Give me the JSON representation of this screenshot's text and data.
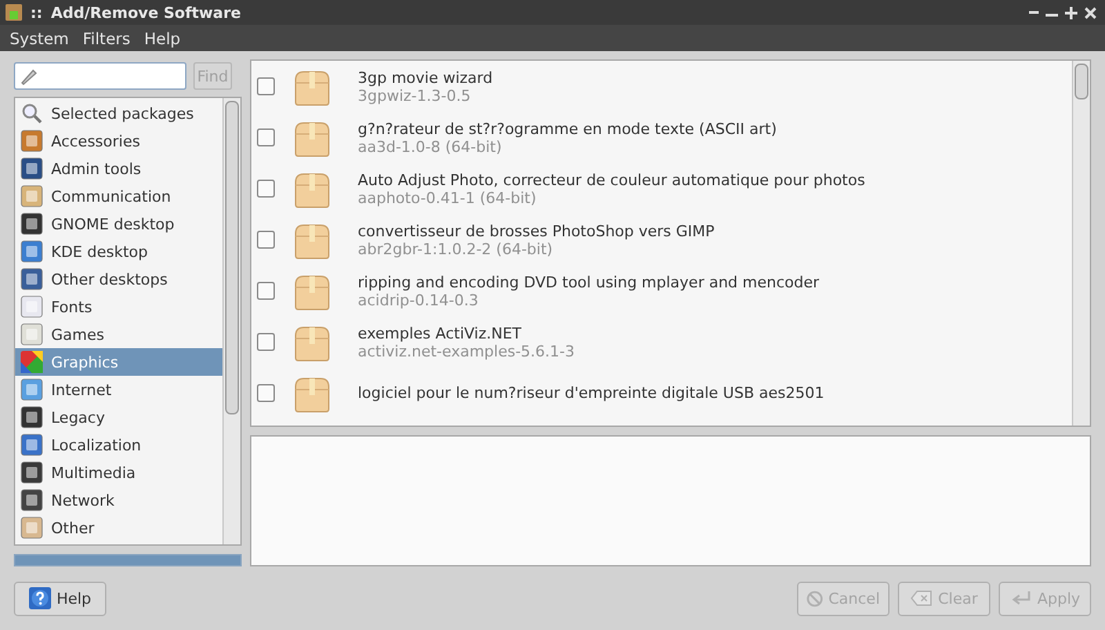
{
  "window": {
    "menu_glyph": "::",
    "title": "Add/Remove Software"
  },
  "menu": [
    "System",
    "Filters",
    "Help"
  ],
  "search": {
    "button": {
      "label": "Find",
      "disabled": true
    }
  },
  "categories": [
    {
      "label": "Selected packages",
      "selected": false
    },
    {
      "label": "Accessories",
      "selected": false
    },
    {
      "label": "Admin tools",
      "selected": false
    },
    {
      "label": "Communication",
      "selected": false
    },
    {
      "label": "GNOME desktop",
      "selected": false
    },
    {
      "label": "KDE desktop",
      "selected": false
    },
    {
      "label": "Other desktops",
      "selected": false
    },
    {
      "label": "Fonts",
      "selected": false
    },
    {
      "label": "Games",
      "selected": false
    },
    {
      "label": "Graphics",
      "selected": true
    },
    {
      "label": "Internet",
      "selected": false
    },
    {
      "label": "Legacy",
      "selected": false
    },
    {
      "label": "Localization",
      "selected": false
    },
    {
      "label": "Multimedia",
      "selected": false
    },
    {
      "label": "Network",
      "selected": false
    },
    {
      "label": "Other",
      "selected": false
    }
  ],
  "packages": [
    {
      "title": "3gp movie wizard",
      "version": "3gpwiz-1.3-0.5",
      "checked": false
    },
    {
      "title": "g?n?rateur de st?r?ogramme en mode texte (ASCII art)",
      "version": "aa3d-1.0-8 (64-bit)",
      "checked": false
    },
    {
      "title": "Auto Adjust Photo, correcteur de couleur automatique pour photos",
      "version": "aaphoto-0.41-1 (64-bit)",
      "checked": false
    },
    {
      "title": "convertisseur de brosses PhotoShop vers GIMP",
      "version": "abr2gbr-1:1.0.2-2 (64-bit)",
      "checked": false
    },
    {
      "title": "ripping and encoding DVD tool using mplayer and mencoder",
      "version": "acidrip-0.14-0.3",
      "checked": false
    },
    {
      "title": "exemples ActiViz.NET",
      "version": "activiz.net-examples-5.6.1-3",
      "checked": false
    },
    {
      "title": "logiciel pour le num?riseur d'empreinte digitale USB aes2501",
      "checked": false
    }
  ],
  "progress": {
    "level": 1
  },
  "help_button": {
    "label": "Help"
  },
  "actions": [
    {
      "label": "Cancel",
      "kind": "cancel",
      "disabled": true
    },
    {
      "label": "Clear",
      "kind": "clear",
      "disabled": true
    },
    {
      "label": "Apply",
      "kind": "apply",
      "disabled": true
    }
  ]
}
